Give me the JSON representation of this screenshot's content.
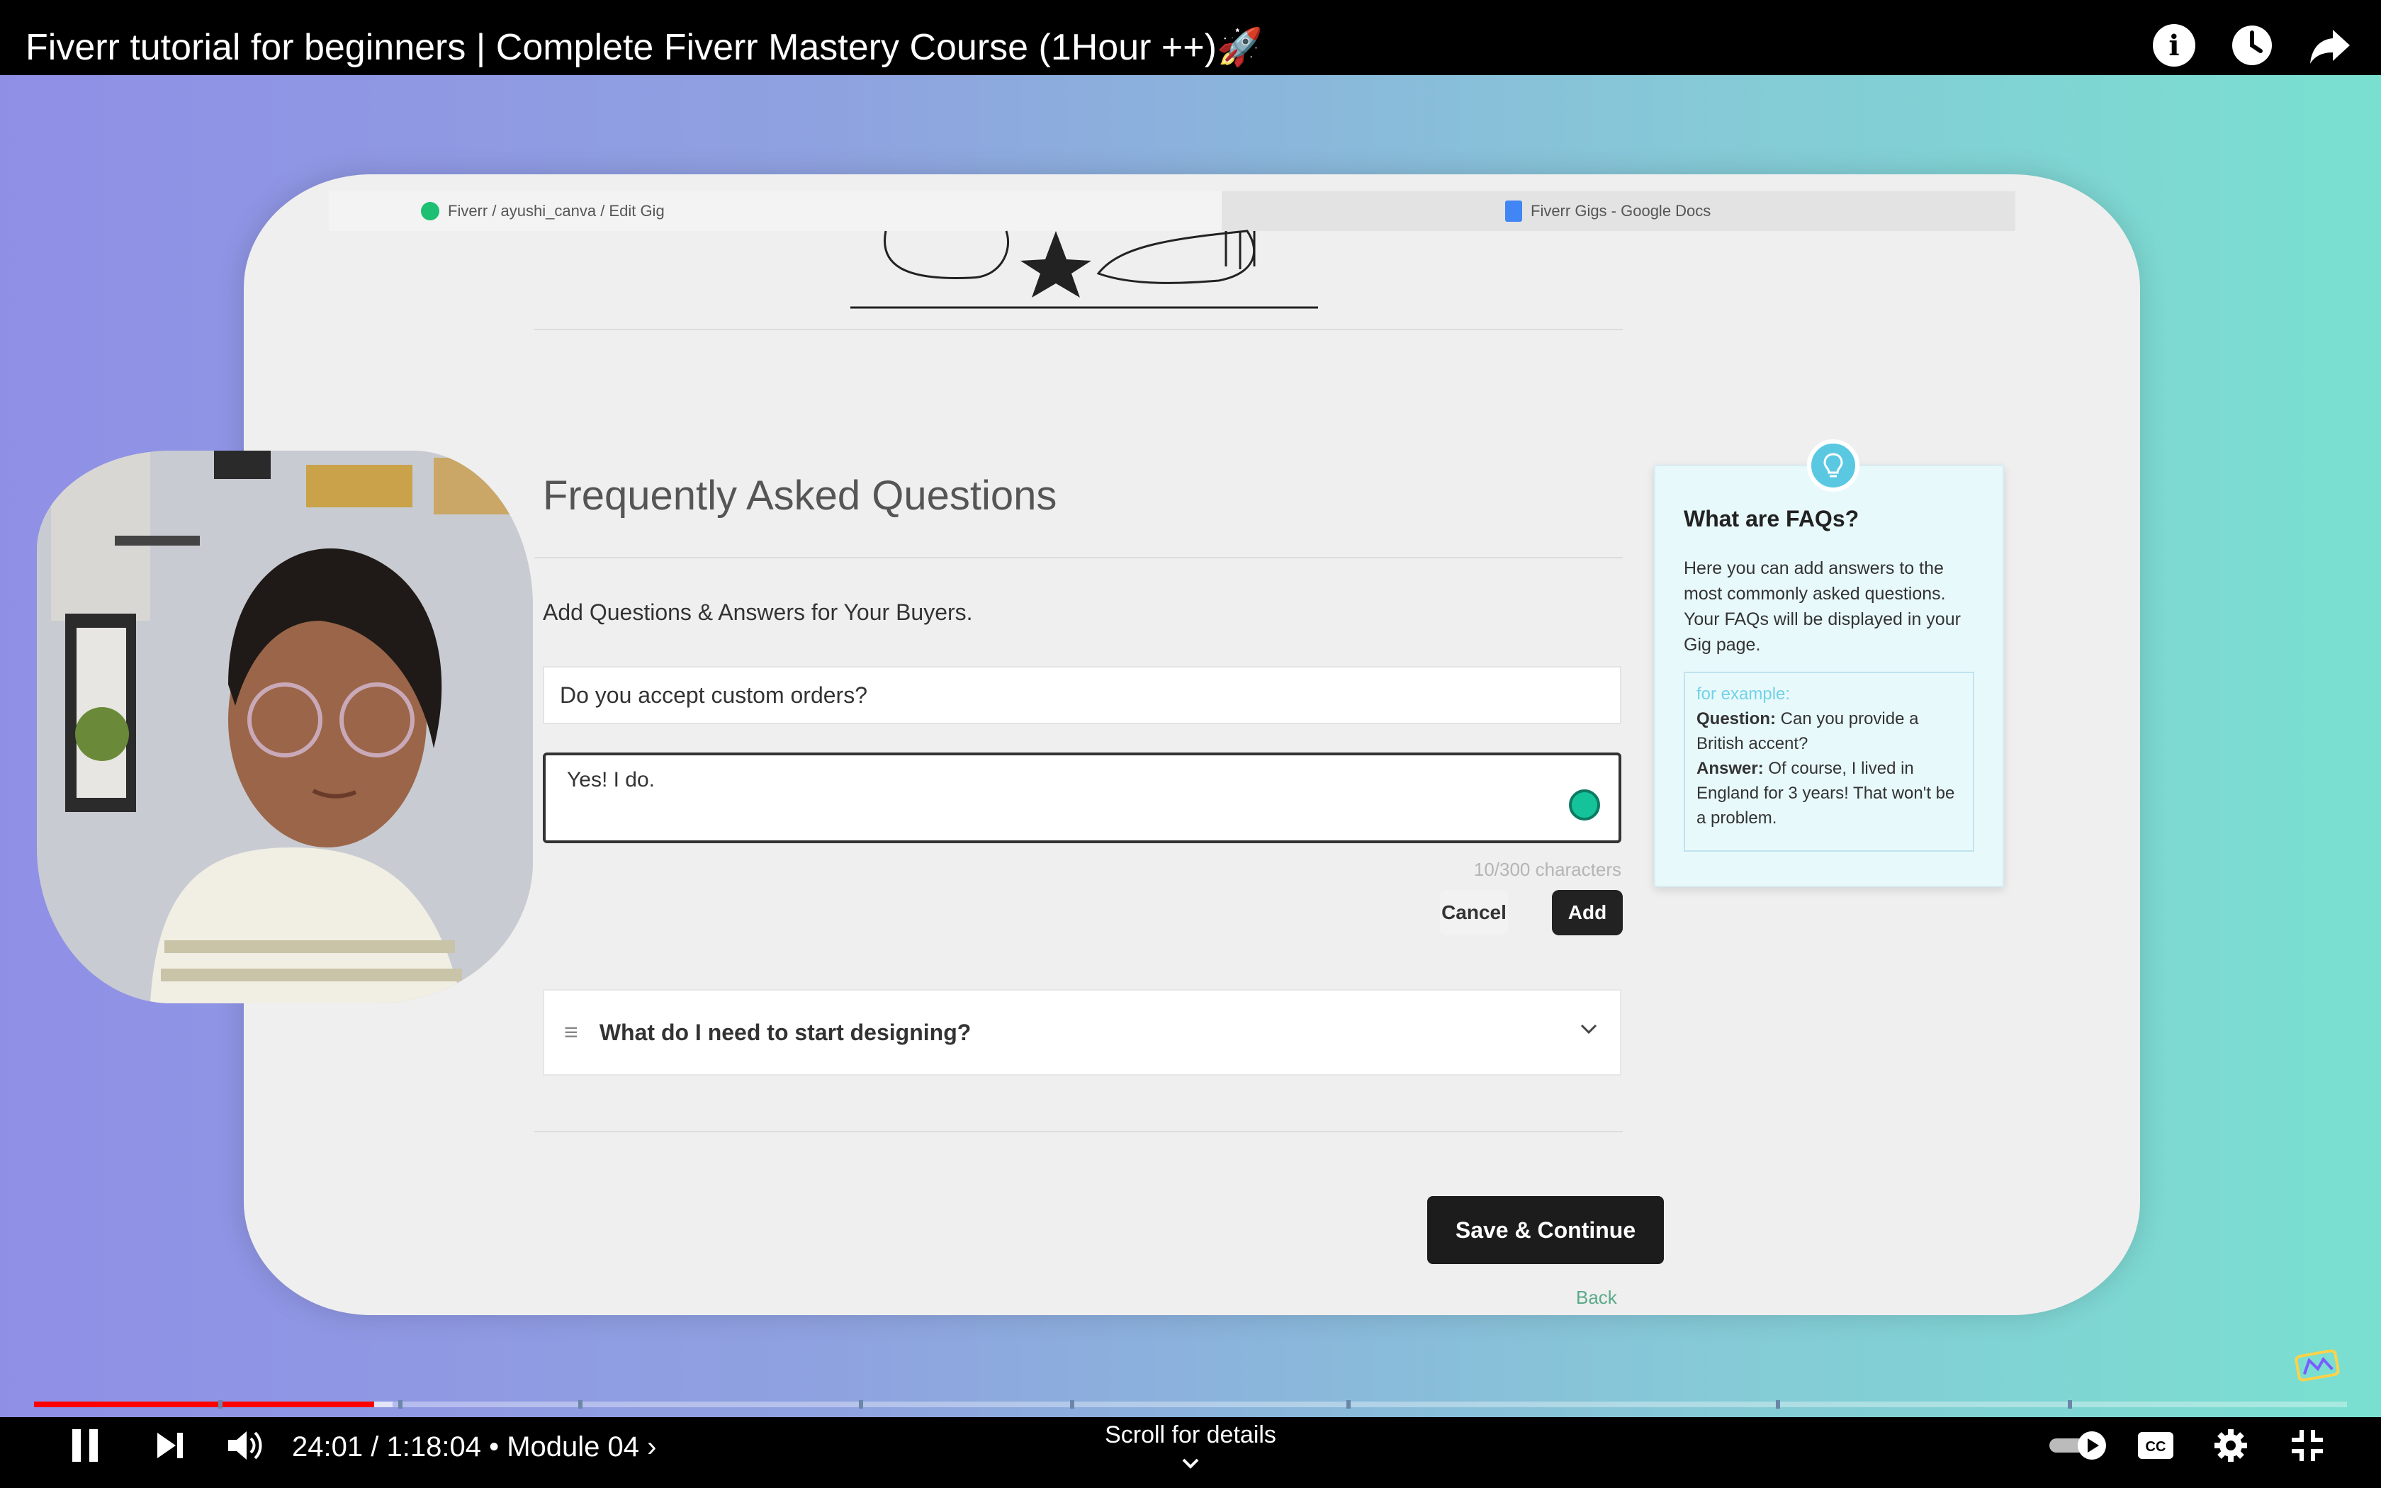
{
  "player": {
    "title": "Fiverr tutorial for beginners | Complete Fiverr Mastery Course (1Hour ++)🚀",
    "current_time": "24:01",
    "separator": "/",
    "duration": "1:18:04",
    "chapter": "Module 04",
    "scroll_hint": "Scroll for details",
    "progress_fraction": 0.147,
    "buffered_fraction": 0.155,
    "icons": [
      "info-icon",
      "watch-later-icon",
      "share-icon",
      "pause-icon",
      "next-icon",
      "volume-icon",
      "autoplay-toggle",
      "captions-icon",
      "settings-icon",
      "exit-fullscreen-icon"
    ]
  },
  "browser": {
    "tabs": [
      {
        "label": "Fiverr / ayushi_canva / Edit Gig"
      },
      {
        "label": "Fiverr Gigs - Google Docs"
      }
    ]
  },
  "faq_page": {
    "title": "Frequently Asked Questions",
    "subtitle": "Add Questions & Answers for Your Buyers.",
    "question_value": "Do you accept custom orders?",
    "answer_value": "Yes! I do.",
    "char_count": "10/300 characters",
    "cancel_label": "Cancel",
    "add_label": "Add",
    "existing_item": "What do I need to start designing?",
    "save_label": "Save & Continue",
    "back_label": "Back"
  },
  "tip": {
    "title": "What are FAQs?",
    "body": "Here you can add answers to the most commonly asked questions. Your FAQs will be displayed in your Gig page.",
    "example_label": "for example:",
    "question_label": "Question:",
    "question_text": " Can you provide a British accent?",
    "answer_label": "Answer:",
    "answer_text": " Of course, I lived in England for 3 years! That won't be a problem."
  },
  "colors": {
    "progress": "#ff0000",
    "fiverr_green": "#1dbf73",
    "tip_accent": "#5bc8e2"
  }
}
